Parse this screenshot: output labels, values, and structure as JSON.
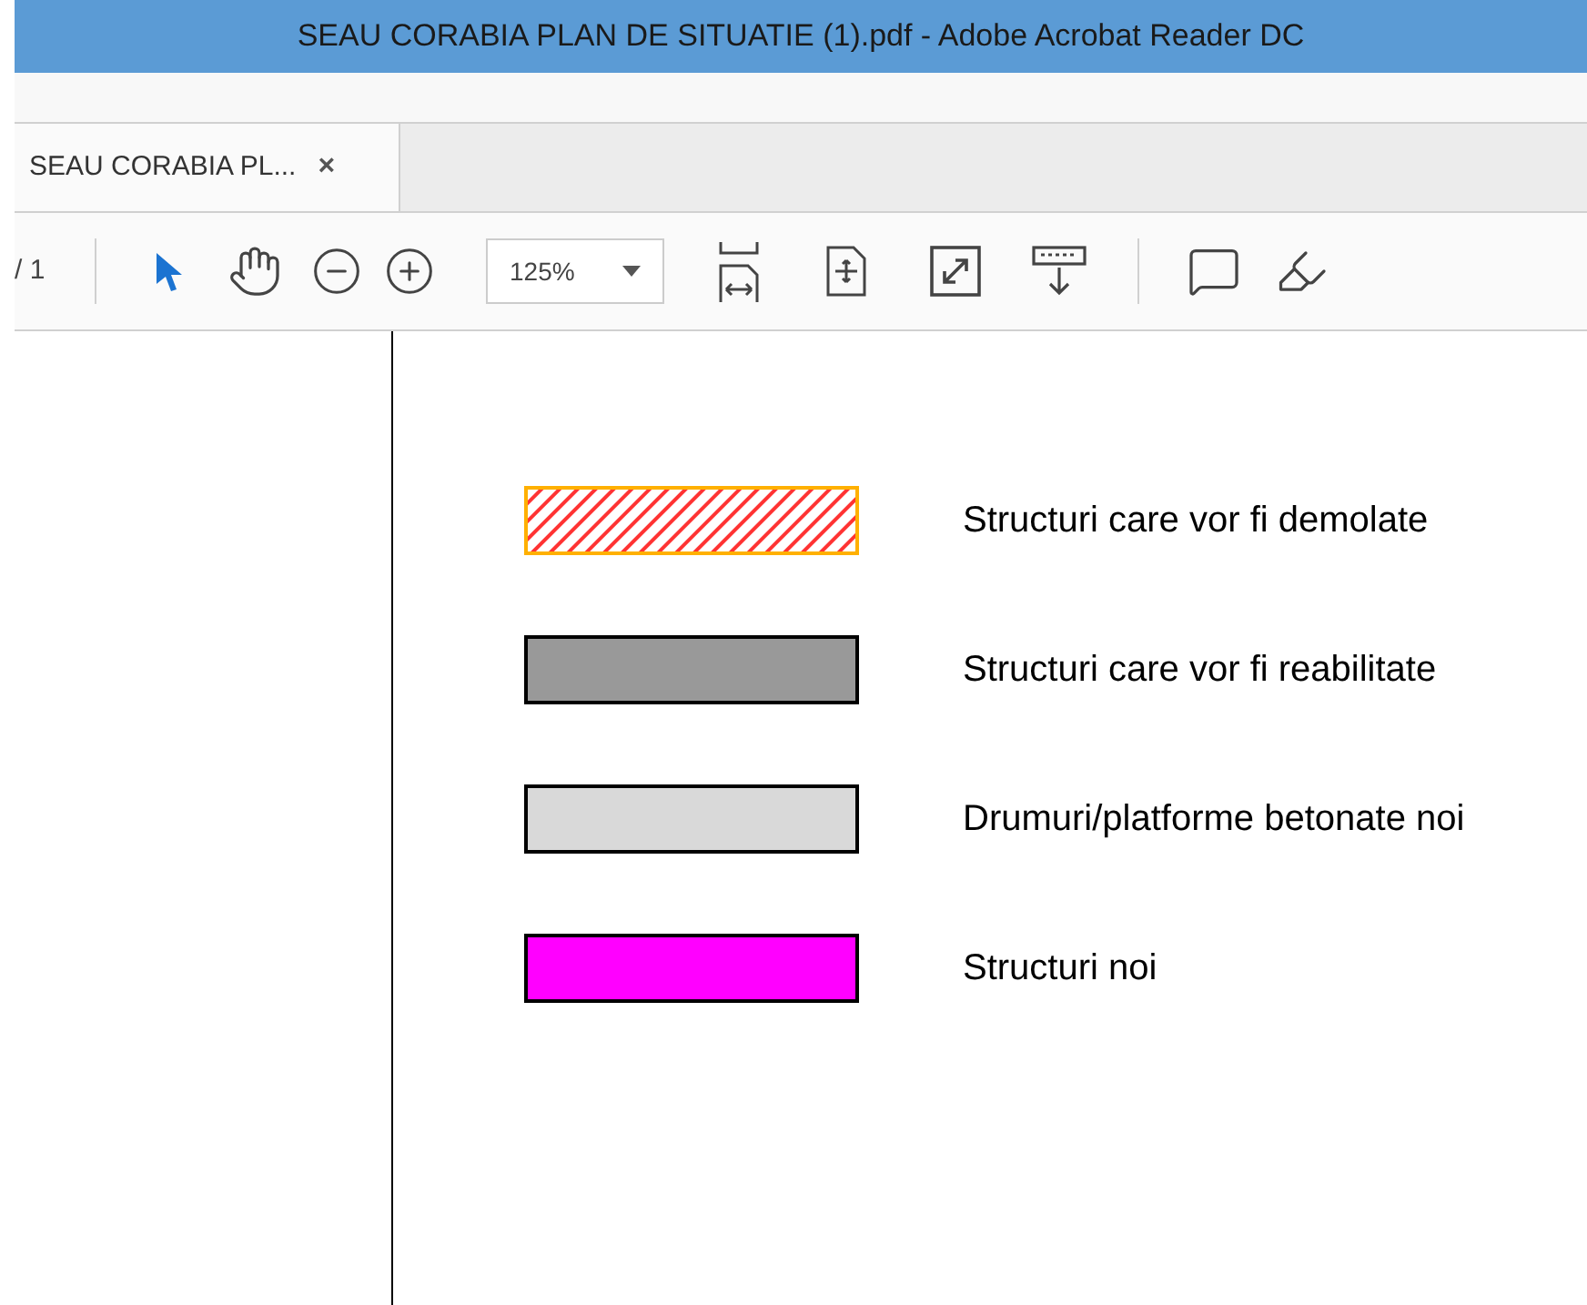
{
  "window": {
    "title": "SEAU CORABIA PLAN DE SITUATIE (1).pdf - Adobe Acrobat Reader DC"
  },
  "tabs": [
    {
      "label": "SEAU CORABIA PL...",
      "close": "×",
      "selected": true
    }
  ],
  "toolbar": {
    "page_count": "/ 1",
    "zoom": "125%"
  },
  "legend": [
    {
      "kind": "hatched",
      "color": "#ff3333",
      "label": "Structuri care vor fi demolate"
    },
    {
      "kind": "solid",
      "color": "#999999",
      "label": "Structuri care vor fi reabilitate"
    },
    {
      "kind": "solid",
      "color": "#d9d9d9",
      "label": "Drumuri/platforme betonate noi"
    },
    {
      "kind": "solid",
      "color": "#ff00ff",
      "label": "Structuri noi"
    }
  ]
}
